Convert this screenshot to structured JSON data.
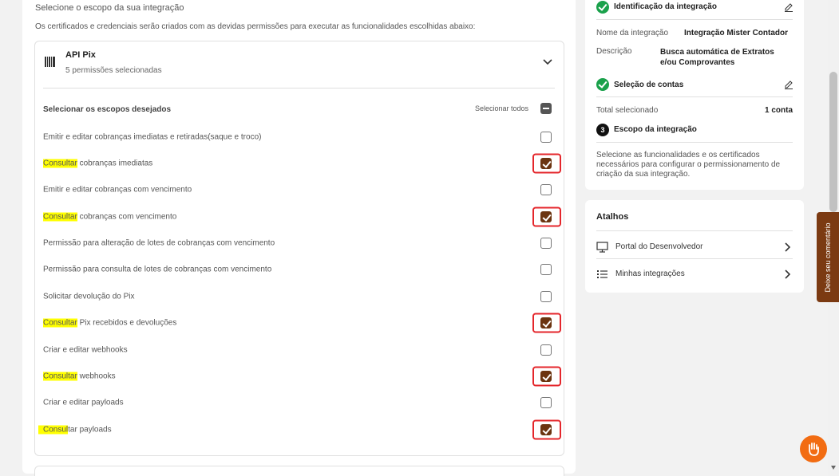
{
  "intro": {
    "title": "Selecione o escopo da sua integração",
    "description": "Os certificados e credenciais serão criados com as devidas permissões para executar as funcionalidades escolhidas abaixo:"
  },
  "api_panel": {
    "title": "API Pix",
    "subtitle": "5 permissões selecionadas",
    "scopes_label": "Selecionar os escopos desejados",
    "select_all_label": "Selecionar todos",
    "permissions": [
      {
        "highlight": "",
        "text": "Emitir e editar cobranças imediatas e retiradas(saque e troco)",
        "checked": false
      },
      {
        "highlight": "Consultar",
        "text": " cobranças imediatas",
        "checked": true
      },
      {
        "highlight": "",
        "text": "Emitir e editar cobranças com vencimento",
        "checked": false
      },
      {
        "highlight": "Consultar",
        "text": " cobranças com vencimento",
        "checked": true
      },
      {
        "highlight": "",
        "text": "Permissão para alteração de lotes de cobranças com vencimento",
        "checked": false
      },
      {
        "highlight": "",
        "text": "Permissão para consulta de lotes de cobranças com vencimento",
        "checked": false
      },
      {
        "highlight": "",
        "text": "Solicitar devolução do Pix",
        "checked": false
      },
      {
        "highlight": "Consultar",
        "text": " Pix recebidos e devoluções",
        "checked": true
      },
      {
        "highlight": "",
        "text": "Criar e editar webhooks",
        "checked": false
      },
      {
        "highlight": "Consultar",
        "text": " webhooks",
        "checked": true
      },
      {
        "highlight": "",
        "text": "Criar e editar payloads",
        "checked": false
      },
      {
        "highlight": "Consul",
        "text": "tar payloads",
        "checked": true
      }
    ]
  },
  "summary": {
    "step1_title": "Identificação da integração",
    "name_key": "Nome da integração",
    "name_value": "Integração Mister Contador",
    "desc_key": "Descrição",
    "desc_value": "Busca automática de Extratos e/ou Comprovantes",
    "step2_title": "Seleção de contas",
    "total_key": "Total selecionado",
    "total_value": "1 conta",
    "step3_number": "3",
    "step3_title": "Escopo da integração",
    "step3_desc": "Selecione as funcionalidades e os certificados necessários para configurar o permissionamento de criação da sua integração."
  },
  "shortcuts": {
    "title": "Atalhos",
    "items": [
      {
        "label": "Portal do Desenvolvedor",
        "icon": "monitor-icon"
      },
      {
        "label": "Minhas integrações",
        "icon": "list-icon"
      }
    ]
  },
  "feedback": {
    "label": "Deixe seu comentário"
  },
  "colors": {
    "accent": "#f26c12",
    "checked": "#6b3410",
    "success": "#1aa14b",
    "annotation": "#e4262b",
    "highlight": "#ffff00"
  }
}
